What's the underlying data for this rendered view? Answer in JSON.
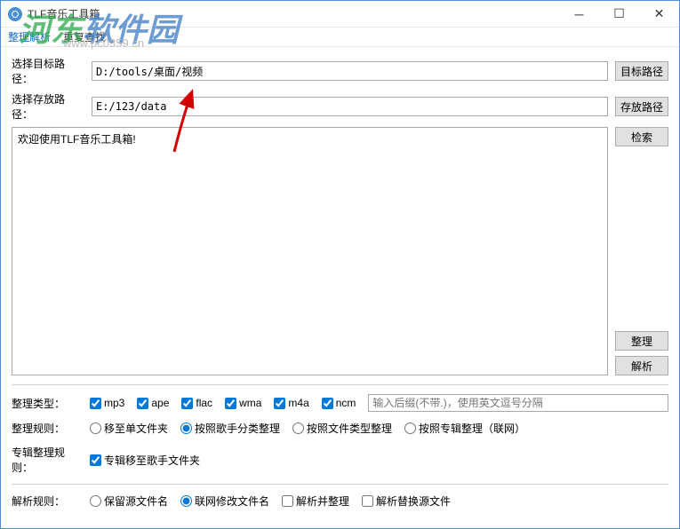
{
  "window": {
    "title": "TLF音乐工具箱"
  },
  "menu": {
    "item1": "整理解析",
    "item2": "重复查找"
  },
  "paths": {
    "target_label": "选择目标路径：",
    "target_value": "D:/tools/桌面/视频",
    "target_btn": "目标路径",
    "save_label": "选择存放路径：",
    "save_value": "E:/123/data",
    "save_btn": "存放路径"
  },
  "log": {
    "welcome": "欢迎使用TLF音乐工具箱!"
  },
  "buttons": {
    "search": "检索",
    "organize": "整理",
    "parse": "解析"
  },
  "type_section": {
    "label": "整理类型：",
    "mp3": "mp3",
    "ape": "ape",
    "flac": "flac",
    "wma": "wma",
    "m4a": "m4a",
    "ncm": "ncm",
    "placeholder": "输入后缀(不带.)，使用英文逗号分隔"
  },
  "organize_rule": {
    "label": "整理规则：",
    "opt1": "移至单文件夹",
    "opt2": "按照歌手分类整理",
    "opt3": "按照文件类型整理",
    "opt4": "按照专辑整理（联网）"
  },
  "album_rule": {
    "label": "专辑整理规则：",
    "opt1": "专辑移至歌手文件夹"
  },
  "parse_rule": {
    "label": "解析规则：",
    "opt1": "保留源文件名",
    "opt2": "联网修改文件名",
    "opt3": "解析并整理",
    "opt4": "解析替换源文件"
  },
  "watermark": {
    "text1": "河东",
    "text2": "软件园",
    "url": "www.pc0359.cn"
  }
}
